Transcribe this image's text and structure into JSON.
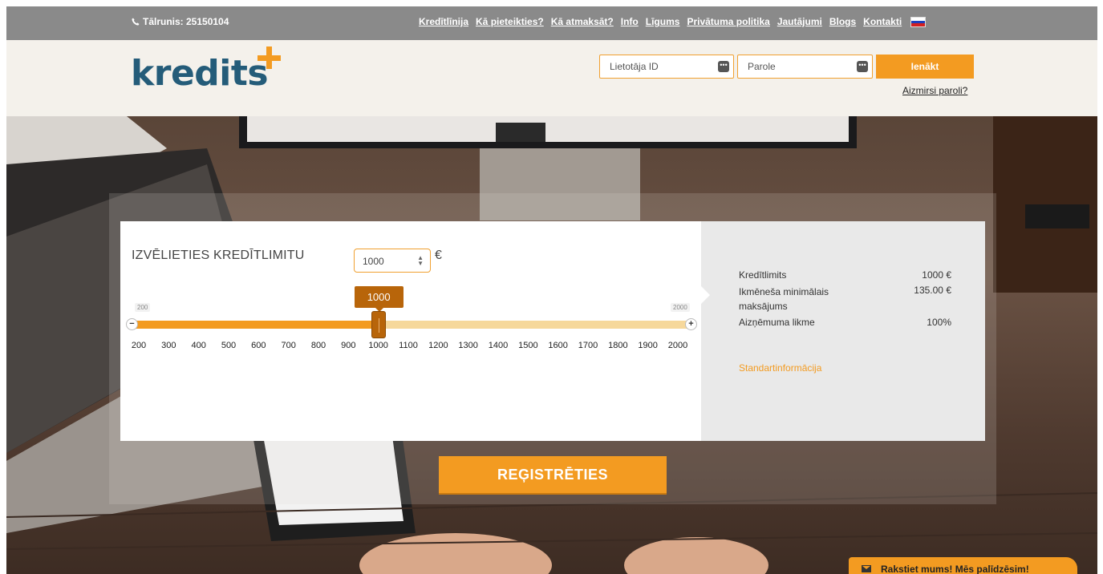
{
  "topbar": {
    "phone": "Tālrunis: 25150104",
    "nav": [
      "Kredītlīnija",
      "Kā pieteikties?",
      "Kā atmaksāt?",
      "Info",
      "Līgums",
      "Privātuma politika",
      "Jautājumi",
      "Blogs",
      "Kontakti"
    ],
    "language_flag": "russian-flag-icon"
  },
  "header": {
    "logo": "kredits",
    "login": {
      "user_placeholder": "Lietotāja ID",
      "password_placeholder": "Parole",
      "submit_label": "Ienākt",
      "forgot_label": "Aizmirsi paroli?"
    }
  },
  "calculator": {
    "title": "IZVĒLIETIES KREDĪTLIMITU",
    "selected_amount": "1000",
    "currency": "€",
    "slider": {
      "min_label": "200",
      "max_label": "2000",
      "value_label": "1000",
      "min": 200,
      "max": 2000,
      "value": 1000,
      "ticks": [
        "200",
        "300",
        "400",
        "500",
        "600",
        "700",
        "800",
        "900",
        "1000",
        "1100",
        "1200",
        "1300",
        "1400",
        "1500",
        "1600",
        "1700",
        "1800",
        "1900",
        "2000"
      ]
    }
  },
  "summary": {
    "rows": [
      {
        "label": "Kredītlimits",
        "value": "1000 €"
      },
      {
        "label": "Ikmēneša minimālais maksājums",
        "value": "135.00 €"
      },
      {
        "label": "Aizņēmuma likme",
        "value": "100%"
      }
    ],
    "info_link": "Standartinformācija"
  },
  "register_label": "REĢISTRĒTIES",
  "chat_label": "Rakstiet mums! Mēs palīdzēsim!",
  "colors": {
    "accent": "#f39b21",
    "handle": "#b8650a",
    "brand": "#245c79"
  }
}
